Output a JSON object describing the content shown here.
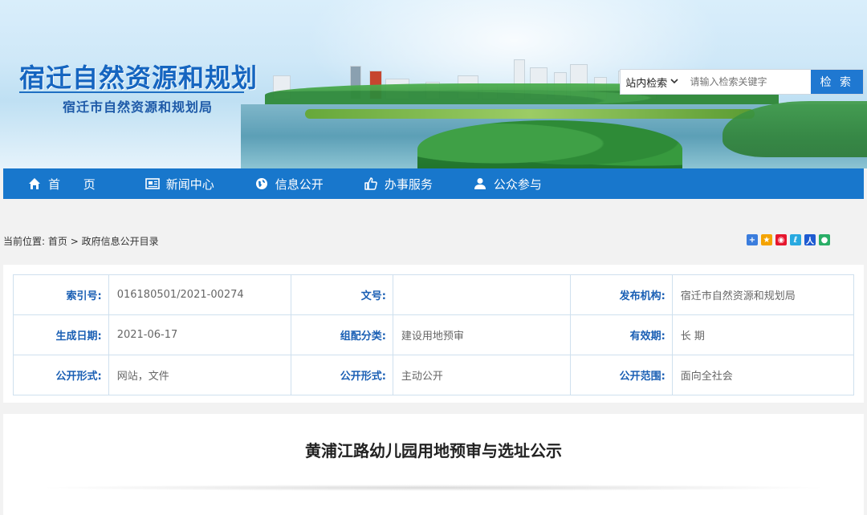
{
  "header": {
    "title": "宿迁自然资源和规划",
    "subtitle": "宿迁市自然资源和规划局"
  },
  "search": {
    "scope": "站内检索",
    "placeholder": "请输入检索关键字",
    "button": "检 索"
  },
  "nav": {
    "items": [
      {
        "label": "首 页",
        "icon": "home-icon"
      },
      {
        "label": "新闻中心",
        "icon": "newspaper-icon"
      },
      {
        "label": "信息公开",
        "icon": "globe-icon"
      },
      {
        "label": "办事服务",
        "icon": "thumbs-up-icon"
      },
      {
        "label": "公众参与",
        "icon": "user-icon"
      }
    ]
  },
  "breadcrumb": {
    "prefix": "当前位置:",
    "home": "首页",
    "separator": ">",
    "current": "政府信息公开目录"
  },
  "share": {
    "icons": [
      "plus-share-icon",
      "qzone-icon",
      "weibo-icon",
      "tencent-weibo-icon",
      "renren-icon",
      "wechat-icon"
    ],
    "colors": [
      "#3b7ddd",
      "#f4a300",
      "#e6162d",
      "#28a9e0",
      "#1f5bd1",
      "#2aae67"
    ]
  },
  "info": {
    "rows": [
      [
        {
          "key": "索引号:",
          "value": "016180501/2021-00274"
        },
        {
          "key": "文号:",
          "value": ""
        },
        {
          "key": "发布机构:",
          "value": "宿迁市自然资源和规划局"
        }
      ],
      [
        {
          "key": "生成日期:",
          "value": "2021-06-17"
        },
        {
          "key": "组配分类:",
          "value": "建设用地预审"
        },
        {
          "key": "有效期:",
          "value": "长 期"
        }
      ],
      [
        {
          "key": "公开形式:",
          "value": "网站，文件"
        },
        {
          "key": "公开形式:",
          "value": "主动公开"
        },
        {
          "key": "公开范围:",
          "value": "面向全社会"
        }
      ]
    ]
  },
  "article": {
    "title": "黄浦江路幼儿园用地预审与选址公示"
  }
}
